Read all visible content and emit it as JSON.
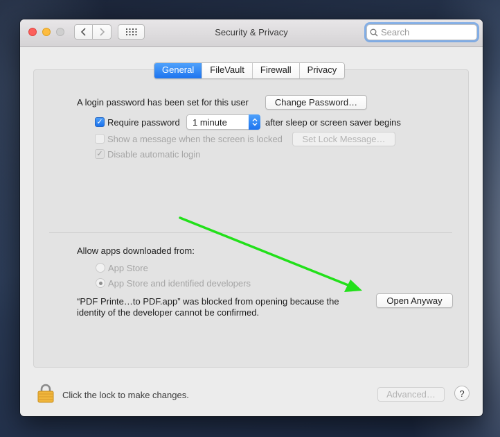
{
  "window": {
    "title": "Security & Privacy"
  },
  "search": {
    "placeholder": "Search"
  },
  "tabs": [
    {
      "label": "General",
      "active": true
    },
    {
      "label": "FileVault",
      "active": false
    },
    {
      "label": "Firewall",
      "active": false
    },
    {
      "label": "Privacy",
      "active": false
    }
  ],
  "general": {
    "login_password_text": "A login password has been set for this user",
    "change_password_label": "Change Password…",
    "require_password_label": "Require password",
    "require_password_checked": true,
    "require_password_interval": "1 minute",
    "after_sleep_text": "after sleep or screen saver begins",
    "show_message_label": "Show a message when the screen is locked",
    "show_message_checked": false,
    "set_lock_message_label": "Set Lock Message…",
    "disable_auto_login_label": "Disable automatic login",
    "disable_auto_login_checked": true
  },
  "allow_apps": {
    "heading": "Allow apps downloaded from:",
    "options": [
      {
        "label": "App Store",
        "selected": false
      },
      {
        "label": "App Store and identified developers",
        "selected": true
      }
    ],
    "blocked_line1": "“PDF Printe…to PDF.app” was blocked from opening because the",
    "blocked_line2": "identity of the developer cannot be confirmed.",
    "open_anyway_label": "Open Anyway"
  },
  "footer": {
    "lock_text": "Click the lock to make changes.",
    "advanced_label": "Advanced…",
    "help_label": "?"
  },
  "icons": {
    "back": "chevron-left-icon",
    "forward": "chevron-right-icon",
    "show_all": "grid-icon",
    "search": "magnifying-glass-icon",
    "lock": "padlock-icon",
    "annotation": "green-arrow-icon"
  },
  "colors": {
    "accent": "#1d74ef",
    "annotation_arrow": "#22e01a"
  }
}
